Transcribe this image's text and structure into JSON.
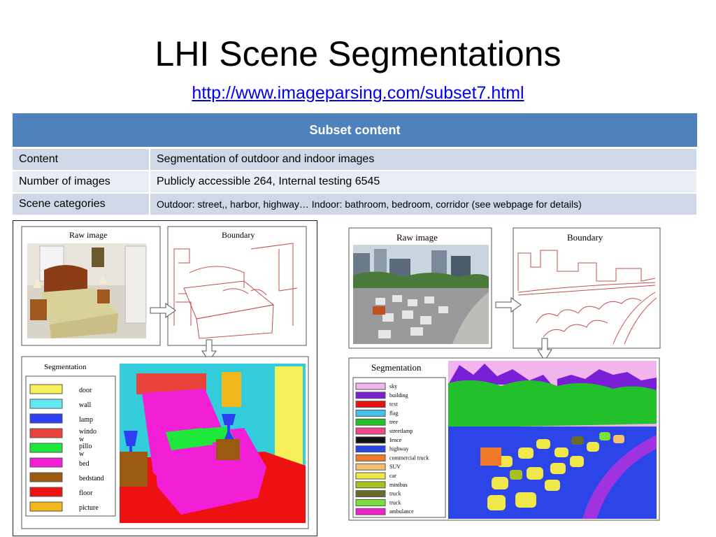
{
  "slide": {
    "title": "LHI Scene Segmentations",
    "link": "http://www.imageparsing.com/subset7.html"
  },
  "table": {
    "header": "Subset content",
    "rows": [
      {
        "label": "Content",
        "value": "Segmentation of outdoor and indoor images"
      },
      {
        "label": "Number of images",
        "value": "Publicly accessible 264,  Internal testing 6545"
      },
      {
        "label": "Scene categories",
        "value": "Outdoor: street,, harbor, highway…  Indoor: bathroom, bedroom, corridor   (see webpage for details)"
      }
    ]
  },
  "indoor_figure": {
    "raw_label": "Raw image",
    "boundary_label": "Boundary",
    "segmentation_label": "Segmentation",
    "legend": [
      {
        "label": "door",
        "color": "#f5f05a"
      },
      {
        "label": "wall",
        "color": "#62e8f0"
      },
      {
        "label": "lamp",
        "color": "#2d3ff0"
      },
      {
        "label": "windo\nw",
        "color": "#e8423a"
      },
      {
        "label": "pillo\nw",
        "color": "#1ee83a"
      },
      {
        "label": "bed",
        "color": "#f21fd6"
      },
      {
        "label": "bedstand",
        "color": "#9a5a12"
      },
      {
        "label": "floor",
        "color": "#ee1111"
      },
      {
        "label": "picture",
        "color": "#f0b81a"
      }
    ]
  },
  "outdoor_figure": {
    "raw_label": "Raw image",
    "boundary_label": "Boundary",
    "segmentation_label": "Segmentation",
    "legend": [
      {
        "label": "sky",
        "color": "#f2b4ec"
      },
      {
        "label": "building",
        "color": "#7a1fd6"
      },
      {
        "label": "text",
        "color": "#ee1111"
      },
      {
        "label": "flag",
        "color": "#40c4ee"
      },
      {
        "label": "tree",
        "color": "#22c02a"
      },
      {
        "label": "streetlamp",
        "color": "#f0468a"
      },
      {
        "label": "fence",
        "color": "#111111"
      },
      {
        "label": "highway",
        "color": "#2c45e8"
      },
      {
        "label": "commercial truck",
        "color": "#f07a2a"
      },
      {
        "label": "SUV",
        "color": "#f5c070"
      },
      {
        "label": "car",
        "color": "#f0e84a"
      },
      {
        "label": "minibus",
        "color": "#a8c020"
      },
      {
        "label": "truck",
        "color": "#6a6a2a"
      },
      {
        "label": "truck",
        "color": "#7ae03a"
      },
      {
        "label": "ambulance",
        "color": "#ee22cc"
      }
    ]
  }
}
